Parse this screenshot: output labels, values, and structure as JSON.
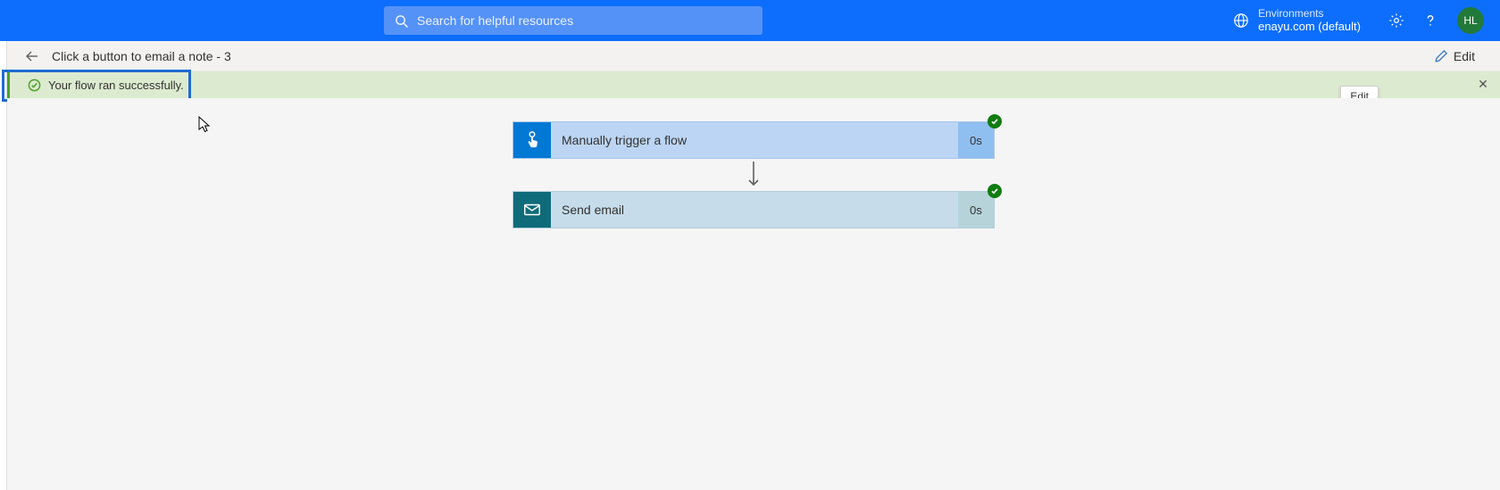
{
  "topbar": {
    "search_placeholder": "Search for helpful resources",
    "environments_label": "Environments",
    "environment_value": "enayu.com (default)",
    "avatar_initials": "HL"
  },
  "cmdbar": {
    "title": "Click a button to email a note - 3",
    "edit_label": "Edit"
  },
  "banner": {
    "success_message": "Your flow ran successfully."
  },
  "tooltip": {
    "edit": "Edit"
  },
  "flow": {
    "steps": [
      {
        "title": "Manually trigger a flow",
        "duration": "0s"
      },
      {
        "title": "Send email",
        "duration": "0s"
      }
    ]
  }
}
